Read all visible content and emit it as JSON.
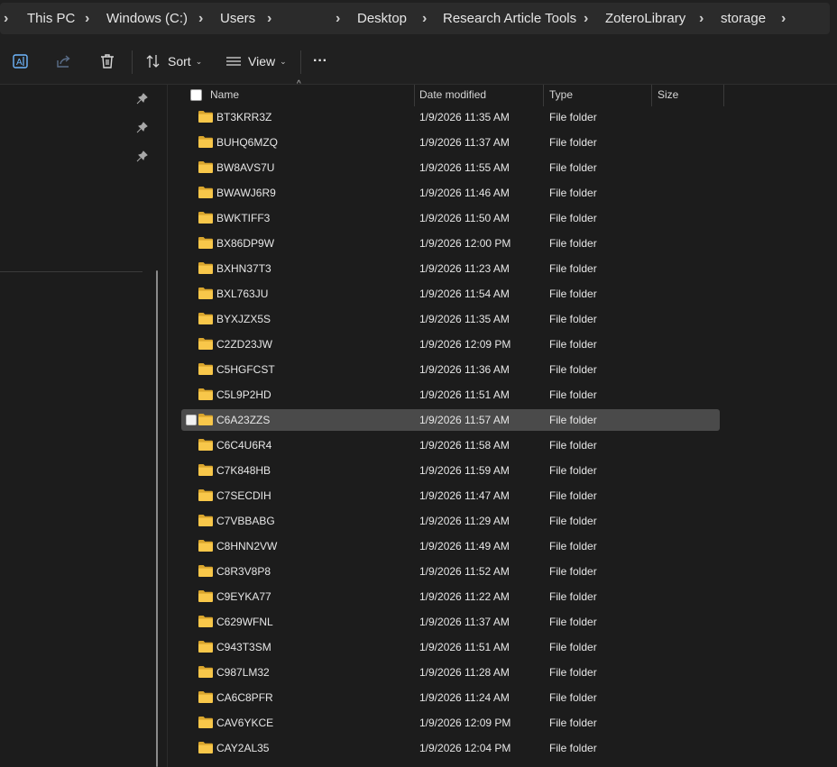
{
  "breadcrumb": {
    "items": [
      "This PC",
      "Windows (C:)",
      "Users",
      "",
      "Desktop",
      "Research Article Tools",
      "ZoteroLibrary",
      "storage"
    ]
  },
  "toolbar": {
    "sort_label": "Sort",
    "view_label": "View",
    "more_label": "···"
  },
  "columns": {
    "name": "Name",
    "date": "Date modified",
    "type": "Type",
    "size": "Size"
  },
  "files": [
    {
      "name": "BT3KRR3Z",
      "date": "1/9/2026 11:35 AM",
      "type": "File folder"
    },
    {
      "name": "BUHQ6MZQ",
      "date": "1/9/2026 11:37 AM",
      "type": "File folder"
    },
    {
      "name": "BW8AVS7U",
      "date": "1/9/2026 11:55 AM",
      "type": "File folder"
    },
    {
      "name": "BWAWJ6R9",
      "date": "1/9/2026 11:46 AM",
      "type": "File folder"
    },
    {
      "name": "BWKTIFF3",
      "date": "1/9/2026 11:50 AM",
      "type": "File folder"
    },
    {
      "name": "BX86DP9W",
      "date": "1/9/2026 12:00 PM",
      "type": "File folder"
    },
    {
      "name": "BXHN37T3",
      "date": "1/9/2026 11:23 AM",
      "type": "File folder"
    },
    {
      "name": "BXL763JU",
      "date": "1/9/2026 11:54 AM",
      "type": "File folder"
    },
    {
      "name": "BYXJZX5S",
      "date": "1/9/2026 11:35 AM",
      "type": "File folder"
    },
    {
      "name": "C2ZD23JW",
      "date": "1/9/2026 12:09 PM",
      "type": "File folder"
    },
    {
      "name": "C5HGFCST",
      "date": "1/9/2026 11:36 AM",
      "type": "File folder"
    },
    {
      "name": "C5L9P2HD",
      "date": "1/9/2026 11:51 AM",
      "type": "File folder"
    },
    {
      "name": "C6A23ZZS",
      "date": "1/9/2026 11:57 AM",
      "type": "File folder",
      "selected": true
    },
    {
      "name": "C6C4U6R4",
      "date": "1/9/2026 11:58 AM",
      "type": "File folder"
    },
    {
      "name": "C7K848HB",
      "date": "1/9/2026 11:59 AM",
      "type": "File folder"
    },
    {
      "name": "C7SECDIH",
      "date": "1/9/2026 11:47 AM",
      "type": "File folder"
    },
    {
      "name": "C7VBBABG",
      "date": "1/9/2026 11:29 AM",
      "type": "File folder"
    },
    {
      "name": "C8HNN2VW",
      "date": "1/9/2026 11:49 AM",
      "type": "File folder"
    },
    {
      "name": "C8R3V8P8",
      "date": "1/9/2026 11:52 AM",
      "type": "File folder"
    },
    {
      "name": "C9EYKA77",
      "date": "1/9/2026 11:22 AM",
      "type": "File folder"
    },
    {
      "name": "C629WFNL",
      "date": "1/9/2026 11:37 AM",
      "type": "File folder"
    },
    {
      "name": "C943T3SM",
      "date": "1/9/2026 11:51 AM",
      "type": "File folder"
    },
    {
      "name": "C987LM32",
      "date": "1/9/2026 11:28 AM",
      "type": "File folder"
    },
    {
      "name": "CA6C8PFR",
      "date": "1/9/2026 11:24 AM",
      "type": "File folder"
    },
    {
      "name": "CAV6YKCE",
      "date": "1/9/2026 12:09 PM",
      "type": "File folder"
    },
    {
      "name": "CAY2AL35",
      "date": "1/9/2026 12:04 PM",
      "type": "File folder"
    }
  ],
  "icons": {
    "rename": "rename-icon",
    "share": "share-icon",
    "delete": "delete-icon",
    "sort": "sort-icon",
    "view": "view-icon",
    "more": "more-icon",
    "pin": "pin-icon",
    "folder": "folder-icon"
  },
  "colors": {
    "accent": "#4cc2ff",
    "folder": "#f8c74a",
    "selected_row": "#4a4a4a",
    "background": "#1c1c1c"
  }
}
